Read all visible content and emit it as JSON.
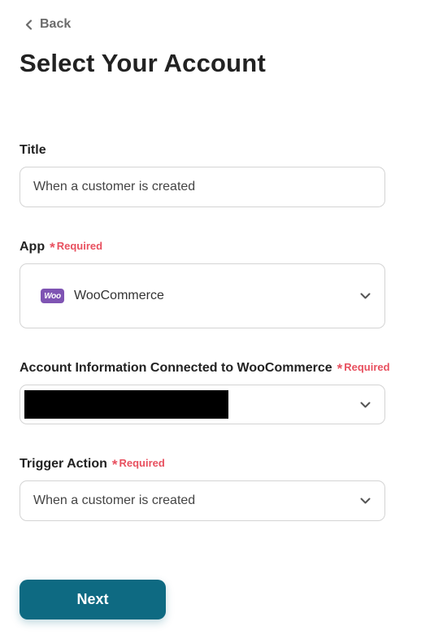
{
  "nav": {
    "back_label": "Back"
  },
  "page": {
    "title": "Select Your Account"
  },
  "form": {
    "title_field": {
      "label": "Title",
      "value": "When a customer is created"
    },
    "app_field": {
      "label": "App",
      "required_label": "Required",
      "app_logo_text": "Woo",
      "value": "WooCommerce"
    },
    "account_field": {
      "label": "Account Information Connected to WooCommerce",
      "required_label": "Required"
    },
    "trigger_field": {
      "label": "Trigger Action",
      "required_label": "Required",
      "value": "When a customer is created"
    },
    "next_label": "Next"
  },
  "colors": {
    "primary_button": "#0e6a82",
    "required": "#e8505f",
    "woo_purple": "#7f54b3"
  },
  "icons": {
    "back": "chevron-left-icon",
    "dropdown": "chevron-down-icon",
    "required": "asterisk-icon",
    "app_logo": "woocommerce-logo-icon"
  }
}
